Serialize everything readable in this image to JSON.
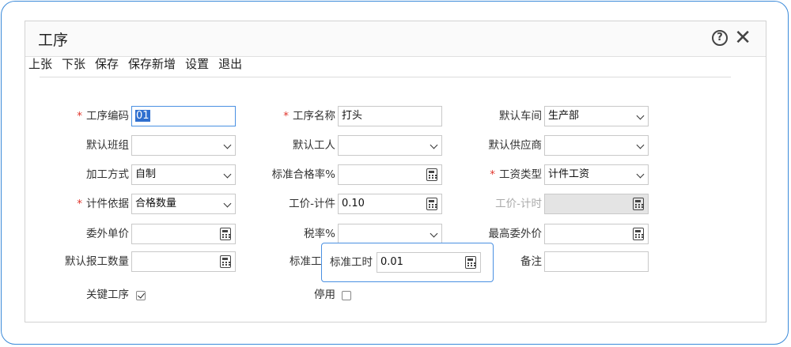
{
  "dialog": {
    "title": "工序"
  },
  "toolbar": {
    "prev": "上张",
    "next": "下张",
    "save": "保存",
    "save_new": "保存新增",
    "settings": "设置",
    "exit": "退出"
  },
  "form": {
    "process_code": {
      "label": "工序编码",
      "value": "01"
    },
    "process_name": {
      "label": "工序名称",
      "value": "打头"
    },
    "default_workshop": {
      "label": "默认车间",
      "value": "生产部"
    },
    "default_team": {
      "label": "默认班组",
      "value": ""
    },
    "default_worker": {
      "label": "默认工人",
      "value": ""
    },
    "default_supplier": {
      "label": "默认供应商",
      "value": ""
    },
    "process_method": {
      "label": "加工方式",
      "value": "自制"
    },
    "std_pass_rate": {
      "label": "标准合格率%",
      "value": ""
    },
    "wage_type": {
      "label": "工资类型",
      "value": "计件工资"
    },
    "piece_basis": {
      "label": "计件依据",
      "value": "合格数量"
    },
    "piece_price": {
      "label": "工价-计件",
      "value": "0.10"
    },
    "time_price": {
      "label": "工价-计时",
      "value": ""
    },
    "outsource_price": {
      "label": "委外单价",
      "value": ""
    },
    "tax_rate": {
      "label": "税率%",
      "value": ""
    },
    "max_outsource_price": {
      "label": "最高委外价",
      "value": ""
    },
    "default_report_qty": {
      "label": "默认报工数量",
      "value": ""
    },
    "std_hours_partial": {
      "label": "标准工"
    },
    "remarks": {
      "label": "备注",
      "value": ""
    },
    "key_process": {
      "label": "关键工序",
      "checked": true
    },
    "disabled": {
      "label": "停用",
      "checked": false
    }
  },
  "popup": {
    "label": "标准工时",
    "value": "0.01"
  },
  "required_mark": "*"
}
